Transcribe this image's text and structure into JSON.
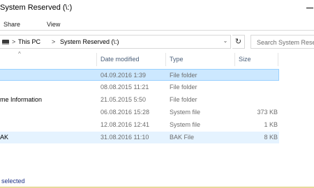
{
  "window": {
    "title": "System Reserved (\\:)"
  },
  "ribbon": {
    "tabs": [
      "Share",
      "View"
    ]
  },
  "address": {
    "drive_icon": "drive-icon",
    "separator": ">",
    "crumbs": [
      "This PC",
      "System Reserved (\\:)"
    ],
    "dropdown_icon": "chevron-down-icon",
    "refresh_icon": "refresh-icon",
    "refresh_glyph": "↻"
  },
  "search": {
    "placeholder": "Search System Reserved (\\:)"
  },
  "columns": {
    "name_caret": "^",
    "date": "Date modified",
    "type": "Type",
    "size": "Size"
  },
  "rows": [
    {
      "name": "",
      "date": "04.09.2016 1:39",
      "type": "File folder",
      "size": "",
      "state": "selected"
    },
    {
      "name": "",
      "date": "08.08.2015 11:21",
      "type": "File folder",
      "size": "",
      "state": ""
    },
    {
      "name": "me Information",
      "date": "21.05.2015 5:50",
      "type": "File folder",
      "size": "",
      "state": ""
    },
    {
      "name": "",
      "date": "06.08.2016 15:28",
      "type": "System file",
      "size": "373 KB",
      "state": ""
    },
    {
      "name": "",
      "date": "12.08.2016 12:41",
      "type": "System file",
      "size": "1 KB",
      "state": ""
    },
    {
      "name": "AK",
      "date": "31.08.2016 11:10",
      "type": "BAK File",
      "size": "8 KB",
      "state": "hover"
    }
  ],
  "status": {
    "text": "selected"
  },
  "colors": {
    "selection": "#cce8ff",
    "selection_border": "#99d1ff",
    "hover": "#e5f3ff",
    "header_text": "#4c607a",
    "status_text": "#1e3287"
  }
}
